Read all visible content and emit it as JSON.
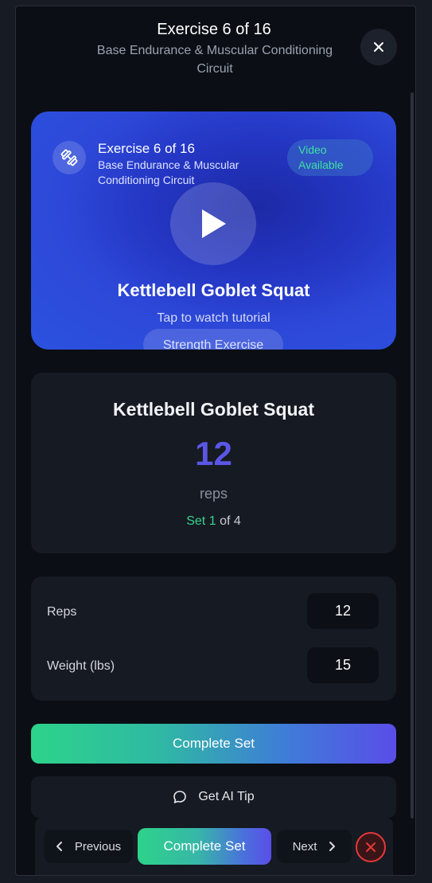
{
  "header": {
    "title": "Exercise 6 of 16",
    "subtitle": "Base Endurance & Muscular Conditioning Circuit",
    "close_icon": "close-icon"
  },
  "video_card": {
    "icon": "dumbbell-icon",
    "title": "Exercise 6 of 16",
    "subtitle": "Base Endurance & Muscular Conditioning Circuit",
    "badge": "Video Available",
    "play_icon": "play-icon",
    "exercise_name": "Kettlebell Goblet Squat",
    "tap_hint": "Tap to watch tutorial",
    "category": "Strength Exercise"
  },
  "exercise": {
    "name": "Kettlebell Goblet Squat",
    "target_reps": "12",
    "unit": "reps",
    "set_prefix": "Set",
    "current_set": "1",
    "set_of": "of 4"
  },
  "inputs": {
    "reps_label": "Reps",
    "reps_value": "12",
    "weight_label": "Weight (lbs)",
    "weight_value": "15"
  },
  "actions": {
    "complete_set": "Complete Set",
    "ai_tip": "Get AI Tip"
  },
  "bottom_bar": {
    "previous": "Previous",
    "complete_set": "Complete Set",
    "next": "Next"
  },
  "colors": {
    "accent_purple": "#5a57e6",
    "accent_green": "#37d38f",
    "danger_red": "#e53838"
  }
}
